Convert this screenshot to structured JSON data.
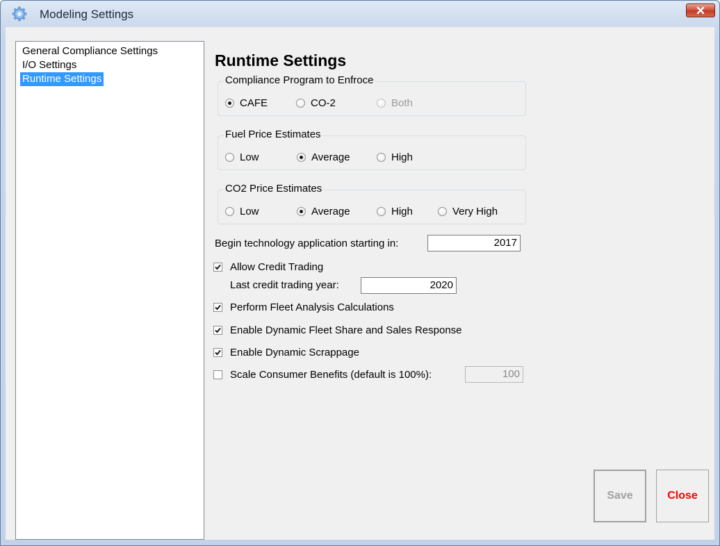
{
  "window": {
    "title": "Modeling Settings",
    "icon": "gear-icon",
    "close_icon": "close-icon"
  },
  "nav": {
    "items": [
      {
        "label": "General Compliance Settings",
        "selected": false
      },
      {
        "label": "I/O Settings",
        "selected": false
      },
      {
        "label": "Runtime Settings",
        "selected": true
      }
    ]
  },
  "page": {
    "heading": "Runtime Settings"
  },
  "compliance": {
    "label": "Compliance Program to Enfroce",
    "options": [
      {
        "label": "CAFE",
        "checked": true,
        "enabled": true
      },
      {
        "label": "CO-2",
        "checked": false,
        "enabled": true
      },
      {
        "label": "Both",
        "checked": false,
        "enabled": false
      }
    ]
  },
  "fuel": {
    "label": "Fuel Price Estimates",
    "options": [
      {
        "label": "Low",
        "checked": false
      },
      {
        "label": "Average",
        "checked": true
      },
      {
        "label": "High",
        "checked": false
      }
    ]
  },
  "co2": {
    "label": "CO2 Price Estimates",
    "options": [
      {
        "label": "Low",
        "checked": false
      },
      {
        "label": "Average",
        "checked": true
      },
      {
        "label": "High",
        "checked": false
      },
      {
        "label": "Very High",
        "checked": false
      }
    ]
  },
  "begin": {
    "label": "Begin technology application starting in:",
    "value": "2017"
  },
  "credit": {
    "label": "Allow Credit Trading",
    "checked": true,
    "last_year_label": "Last credit trading year:",
    "last_year_value": "2020"
  },
  "fleet_analysis": {
    "label": "Perform Fleet Analysis Calculations",
    "checked": true
  },
  "dynamic_fleet": {
    "label": "Enable Dynamic Fleet Share and Sales Response",
    "checked": true
  },
  "scrappage": {
    "label": "Enable Dynamic Scrappage",
    "checked": true
  },
  "consumer": {
    "label": "Scale Consumer Benefits (default is 100%):",
    "checked": false,
    "value": "100"
  },
  "buttons": {
    "save": "Save",
    "close": "Close"
  },
  "colors": {
    "selection": "#3399ff",
    "close_text": "#ff0000",
    "disabled_text": "#a0a0a0"
  }
}
